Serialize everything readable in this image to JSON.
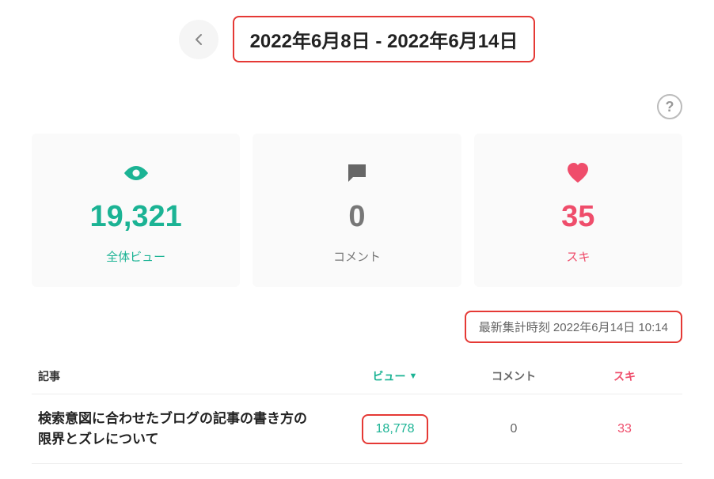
{
  "date_range": "2022年6月8日  -  2022年6月14日",
  "help_symbol": "?",
  "stats": {
    "views": {
      "value": "19,321",
      "label": "全体ビュー"
    },
    "comments": {
      "value": "0",
      "label": "コメント"
    },
    "likes": {
      "value": "35",
      "label": "スキ"
    }
  },
  "timestamp": "最新集計時刻 2022年6月14日 10:14",
  "table": {
    "headers": {
      "title": "記事",
      "views": "ビュー",
      "comments": "コメント",
      "likes": "スキ"
    },
    "rows": [
      {
        "title": "検索意図に合わせたブログの記事の書き方の限界とズレについて",
        "views": "18,778",
        "comments": "0",
        "likes": "33"
      }
    ]
  }
}
